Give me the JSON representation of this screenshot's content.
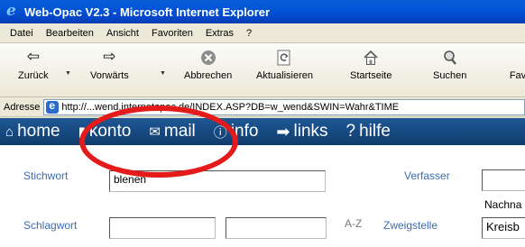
{
  "window": {
    "title": "Web-Opac V2.3 - Microsoft Internet Explorer"
  },
  "menu": [
    "Datei",
    "Bearbeiten",
    "Ansicht",
    "Favoriten",
    "Extras",
    "?"
  ],
  "toolbar": {
    "back_label": "Zurück",
    "forward_label": "Vorwärts",
    "stop_label": "Abbrechen",
    "refresh_label": "Aktualisieren",
    "home_label": "Startseite",
    "search_label": "Suchen",
    "favorites_label": "Fav"
  },
  "address": {
    "label": "Adresse",
    "url": "http://...wend.internetopac.de/INDEX.ASP?DB=w_wend&SWIN=Wahr&TIME"
  },
  "opac_nav": {
    "home": "home",
    "konto": "konto",
    "mail": "mail",
    "info": "info",
    "links": "links",
    "hilfe": "hilfe"
  },
  "form": {
    "stichwort_label": "Stichwort",
    "stichwort_value": "blenen",
    "verfasser_label": "Verfasser",
    "nachname_label": "Nachna",
    "schlagwort_label": "Schlagwort",
    "az_label": "A-Z",
    "zweigstelle_label": "Zweigstelle",
    "zweigstelle_value": "Kreisb"
  },
  "colors": {
    "title_bar": "#0254d6",
    "opac_nav_bg": "#1a4f8a",
    "label_blue": "#3d6cae",
    "annotation_red": "#e51b1b"
  }
}
